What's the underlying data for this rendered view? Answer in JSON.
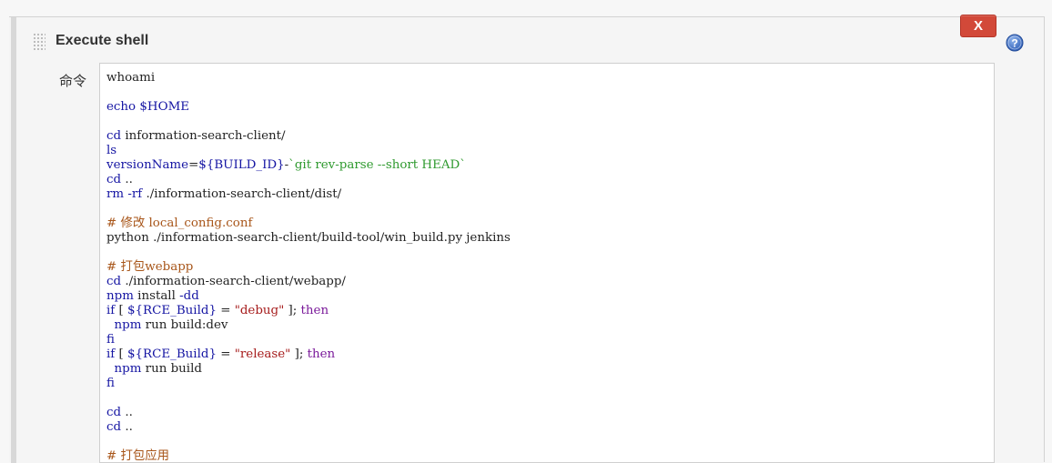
{
  "section": {
    "title": "Execute shell",
    "delete_label": "X",
    "field_label": "命令"
  },
  "icons": {
    "help": "help-icon",
    "drag": "drag-handle-icon"
  },
  "colors": {
    "delete_button": "#d24939",
    "help_icon": "#3b6cc4",
    "keyword": "#1515a3",
    "control_keyword": "#7a1a9a",
    "string": "#2f9a2f",
    "quoted": "#a61c1c",
    "comment": "#a8561a"
  },
  "script_lines": [
    [
      {
        "t": "whoami",
        "c": ""
      }
    ],
    [],
    [
      {
        "t": "echo",
        "c": "kw"
      },
      {
        "t": " ",
        "c": ""
      },
      {
        "t": "$HOME",
        "c": "var"
      }
    ],
    [],
    [
      {
        "t": "cd",
        "c": "kw"
      },
      {
        "t": " information-search-client/",
        "c": ""
      }
    ],
    [
      {
        "t": "ls",
        "c": "kw"
      }
    ],
    [
      {
        "t": "versionName",
        "c": "kw"
      },
      {
        "t": "=",
        "c": ""
      },
      {
        "t": "${BUILD_ID}",
        "c": "var"
      },
      {
        "t": "-",
        "c": ""
      },
      {
        "t": "`git rev-parse --short HEAD`",
        "c": "str"
      }
    ],
    [
      {
        "t": "cd",
        "c": "kw"
      },
      {
        "t": " ..",
        "c": ""
      }
    ],
    [
      {
        "t": "rm",
        "c": "kw"
      },
      {
        "t": " ",
        "c": ""
      },
      {
        "t": "-rf",
        "c": "kw"
      },
      {
        "t": " ./information-search-client/dist/",
        "c": ""
      }
    ],
    [],
    [
      {
        "t": "# 修改 local_config.conf",
        "c": "cm"
      }
    ],
    [
      {
        "t": "python ./information-search-client/build-tool/win_build.py jenkins",
        "c": ""
      }
    ],
    [],
    [
      {
        "t": "# 打包webapp",
        "c": "cm"
      }
    ],
    [
      {
        "t": "cd",
        "c": "kw"
      },
      {
        "t": " ./information-search-client/webapp/",
        "c": ""
      }
    ],
    [
      {
        "t": "npm",
        "c": "kw"
      },
      {
        "t": " install ",
        "c": ""
      },
      {
        "t": "-dd",
        "c": "kw"
      }
    ],
    [
      {
        "t": "if",
        "c": "kw"
      },
      {
        "t": " [ ",
        "c": ""
      },
      {
        "t": "${RCE_Build}",
        "c": "var"
      },
      {
        "t": " = ",
        "c": ""
      },
      {
        "t": "\"debug\"",
        "c": "dq"
      },
      {
        "t": " ]; ",
        "c": ""
      },
      {
        "t": "then",
        "c": "kw2"
      }
    ],
    [
      {
        "t": "  ",
        "c": ""
      },
      {
        "t": "npm",
        "c": "kw"
      },
      {
        "t": " run build:dev",
        "c": ""
      }
    ],
    [
      {
        "t": "fi",
        "c": "kw"
      }
    ],
    [
      {
        "t": "if",
        "c": "kw"
      },
      {
        "t": " [ ",
        "c": ""
      },
      {
        "t": "${RCE_Build}",
        "c": "var"
      },
      {
        "t": " = ",
        "c": ""
      },
      {
        "t": "\"release\"",
        "c": "dq"
      },
      {
        "t": " ]; ",
        "c": ""
      },
      {
        "t": "then",
        "c": "kw2"
      }
    ],
    [
      {
        "t": "  ",
        "c": ""
      },
      {
        "t": "npm",
        "c": "kw"
      },
      {
        "t": " run build",
        "c": ""
      }
    ],
    [
      {
        "t": "fi",
        "c": "kw"
      }
    ],
    [],
    [
      {
        "t": "cd",
        "c": "kw"
      },
      {
        "t": " ..",
        "c": ""
      }
    ],
    [
      {
        "t": "cd",
        "c": "kw"
      },
      {
        "t": " ..",
        "c": ""
      }
    ],
    [],
    [
      {
        "t": "# 打包应用",
        "c": "cm"
      }
    ]
  ]
}
